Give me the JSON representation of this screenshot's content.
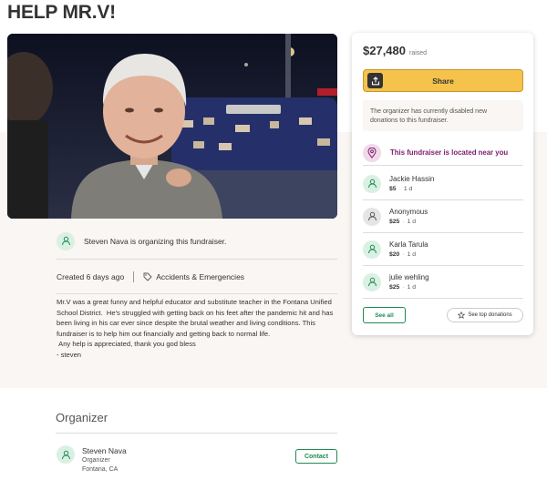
{
  "page": {
    "title": "HELP MR.V!"
  },
  "organizer_line": {
    "text": "Steven Nava is organizing this fundraiser."
  },
  "meta": {
    "created": "Created 6 days ago",
    "category": "Accidents & Emergencies"
  },
  "description": {
    "text": "Mr.V was a great funny and helpful educator and substitute teacher in the Fontana Unified School District.  He's struggled with getting back on his feet after the pandemic hit and has been living in his car ever since despite the brutal weather and living conditions. This fundraiser is to help him out financially and getting back to normal life.\n Any help is appreciated, thank you god bless\n- steven"
  },
  "card": {
    "amount": "$27,480",
    "raised_label": "raised",
    "share_label": "Share",
    "disabled_note": "The organizer has currently disabled new donations to this fundraiser.",
    "near_label": "This fundraiser is located near you",
    "donors": [
      {
        "name": "Jackie Hassin",
        "amount": "$5",
        "time": "1 d",
        "avatar": "green"
      },
      {
        "name": "Anonymous",
        "amount": "$25",
        "time": "1 d",
        "avatar": "grey"
      },
      {
        "name": "Karla Tarula",
        "amount": "$20",
        "time": "1 d",
        "avatar": "green"
      },
      {
        "name": "julie wehling",
        "amount": "$25",
        "time": "1 d",
        "avatar": "green"
      }
    ],
    "see_all_label": "See all",
    "see_top_label": "See top donations"
  },
  "organizer": {
    "heading": "Organizer",
    "name": "Steven Nava",
    "role": "Organizer",
    "location": "Fontana, CA",
    "contact_label": "Contact"
  },
  "colors": {
    "accent_green": "#1f8a52",
    "share_yellow": "#f5c34c",
    "near_purple": "#7b1b6b",
    "background_beige": "#f9f6f3"
  },
  "icons": {
    "share": "share-icon",
    "tag": "tag-icon",
    "location": "location-pin-icon",
    "donor": "donor-avatar-icon",
    "star": "star-icon"
  }
}
